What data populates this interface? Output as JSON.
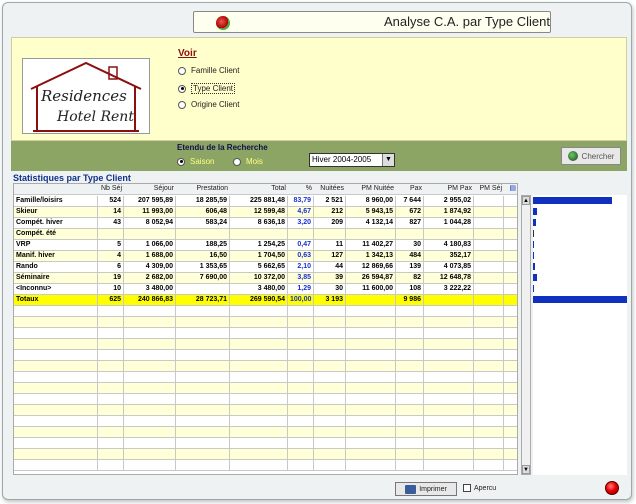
{
  "window": {
    "title": "Analyse C.A. par Type Client"
  },
  "logo": {
    "line1": "Residences",
    "line2": "Hotel Rent"
  },
  "voir": {
    "title": "Voir",
    "options": [
      {
        "label": "Famille Client",
        "selected": false
      },
      {
        "label": "Type Client",
        "selected": true
      },
      {
        "label": "Origine Client",
        "selected": false
      }
    ]
  },
  "search": {
    "title": "Etendu de la Recherche",
    "saison_label": "Saison",
    "mois_label": "Mois",
    "period_value": "Hiver 2004-2005",
    "chercher_label": "Chercher"
  },
  "stats": {
    "title": "Statistiques par Type Client",
    "columns": [
      "Nb Séj",
      "Séjour",
      "Prestation",
      "Total",
      "%",
      "Nuitées",
      "PM Nuitée",
      "Pax",
      "PM Pax",
      "PM Séj"
    ],
    "rows": [
      {
        "name": "Famille/loisirs",
        "nb": "524",
        "sejour": "207 595,89",
        "prest": "18 285,59",
        "total": "225 881,48",
        "pct": "83,79",
        "nuit": "2 521",
        "pmn": "8 960,00",
        "pax": "7 644",
        "pmp": "2 955,02",
        "pms": ""
      },
      {
        "name": "Skieur",
        "nb": "14",
        "sejour": "11 993,00",
        "prest": "606,48",
        "total": "12 599,48",
        "pct": "4,67",
        "nuit": "212",
        "pmn": "5 943,15",
        "pax": "672",
        "pmp": "1 874,92",
        "pms": ""
      },
      {
        "name": "Compét. hiver",
        "nb": "43",
        "sejour": "8 052,94",
        "prest": "583,24",
        "total": "8 636,18",
        "pct": "3,20",
        "nuit": "209",
        "pmn": "4 132,14",
        "pax": "827",
        "pmp": "1 044,28",
        "pms": ""
      },
      {
        "name": "Compét. été",
        "nb": "",
        "sejour": "",
        "prest": "",
        "total": "",
        "pct": "",
        "nuit": "",
        "pmn": "",
        "pax": "",
        "pmp": "",
        "pms": ""
      },
      {
        "name": "VRP",
        "nb": "5",
        "sejour": "1 066,00",
        "prest": "188,25",
        "total": "1 254,25",
        "pct": "0,47",
        "nuit": "11",
        "pmn": "11 402,27",
        "pax": "30",
        "pmp": "4 180,83",
        "pms": ""
      },
      {
        "name": "Manif. hiver",
        "nb": "4",
        "sejour": "1 688,00",
        "prest": "16,50",
        "total": "1 704,50",
        "pct": "0,63",
        "nuit": "127",
        "pmn": "1 342,13",
        "pax": "484",
        "pmp": "352,17",
        "pms": ""
      },
      {
        "name": "Rando",
        "nb": "6",
        "sejour": "4 309,00",
        "prest": "1 353,65",
        "total": "5 662,65",
        "pct": "2,10",
        "nuit": "44",
        "pmn": "12 869,66",
        "pax": "139",
        "pmp": "4 073,85",
        "pms": ""
      },
      {
        "name": "Séminaire",
        "nb": "19",
        "sejour": "2 682,00",
        "prest": "7 690,00",
        "total": "10 372,00",
        "pct": "3,85",
        "nuit": "39",
        "pmn": "26 594,87",
        "pax": "82",
        "pmp": "12 648,78",
        "pms": ""
      },
      {
        "name": "<Inconnu>",
        "nb": "10",
        "sejour": "3 480,00",
        "prest": "",
        "total": "3 480,00",
        "pct": "1,29",
        "nuit": "30",
        "pmn": "11 600,00",
        "pax": "108",
        "pmp": "3 222,22",
        "pms": ""
      }
    ],
    "totals": {
      "name": "Totaux",
      "nb": "625",
      "sejour": "240 866,83",
      "prest": "28 723,71",
      "total": "269 590,54",
      "pct": "100,00",
      "nuit": "3 193",
      "pmn": "",
      "pax": "9 986",
      "pmp": "",
      "pms": ""
    },
    "bar_pct": [
      83.79,
      4.67,
      3.2,
      0,
      0.47,
      0.63,
      2.1,
      3.85,
      1.29,
      100
    ]
  },
  "bottom": {
    "imprimer_label": "Imprimer",
    "apercu_label": "Apercu"
  },
  "colors": {
    "bar": "#1030c0",
    "total_row": "#ffff00",
    "alt_row": "#ffffd8",
    "header_green": "#8ca464",
    "panel_yellow": "#ffffcc"
  }
}
